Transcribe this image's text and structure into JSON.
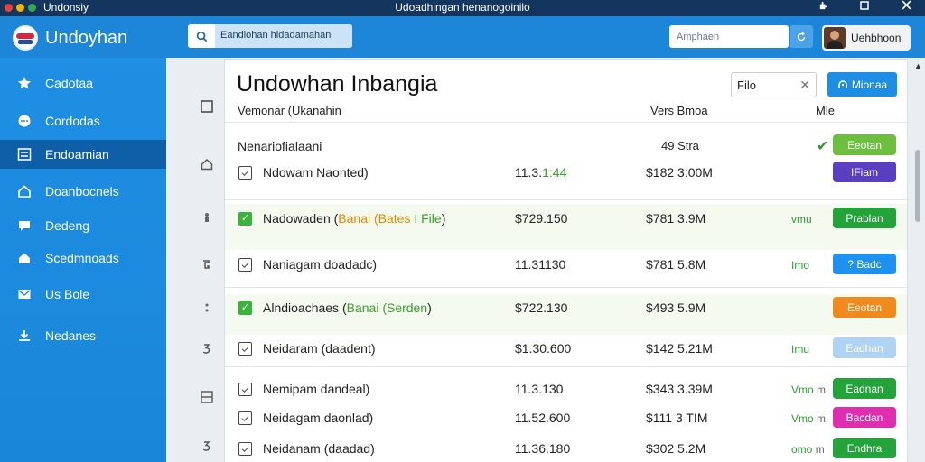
{
  "titlebar": {
    "app_name": "Undonsiy",
    "window_title": "Udoadhingan henanogoinilo",
    "dot_colors": [
      "#e8433a",
      "#f4b400",
      "#34a853"
    ]
  },
  "header": {
    "brand": "Undoyhan",
    "search_text": "Eandiohan hidadamahan",
    "search2_placeholder": "Amphaen",
    "user_name": "Uehbhoon"
  },
  "sidebar": {
    "items": [
      {
        "label": "Cadotaa",
        "icon": "star-icon"
      },
      {
        "label": "Cordodas",
        "icon": "chat-icon"
      },
      {
        "label": "Endoamian",
        "icon": "list-icon"
      },
      {
        "label": "Doanbocnels",
        "icon": "home-icon"
      },
      {
        "label": "Dedeng",
        "icon": "chat-icon"
      },
      {
        "label": "Scedmnoads",
        "icon": "home-icon"
      },
      {
        "label": "Us Bole",
        "icon": "mail-icon"
      },
      {
        "label": "Nedanes",
        "icon": "download-icon"
      }
    ]
  },
  "main": {
    "title": "Undowhan Inbangia",
    "filter_label": "Filo",
    "primary_button": "Mionaa",
    "columns": [
      "Vemonar (Ukanahin",
      "Vers Bmoa",
      "Mle"
    ],
    "group": {
      "label": "Nenariofialaani",
      "version": "49 Stra",
      "status_label": "Eeotan"
    },
    "rows": [
      {
        "name": "Ndowam Naonted)",
        "paren": "",
        "v1": "11.3.",
        "v1_green": "1:44",
        "v2": "$182 3:00M",
        "tag": "",
        "tag_x": "",
        "pill": "IFiam",
        "pill_color": "#5a3fc0",
        "checked": false
      },
      {
        "name": "Nadowaden (",
        "paren": "Banai (Bates",
        "paren2": " I File",
        "paren_end": ")",
        "v1": "$729.150",
        "v1_green": "",
        "v2": "$781 3.9M",
        "tag": "vmu",
        "tag_x": "",
        "pill": "Prablan",
        "pill_color": "#23a33a",
        "checked": true
      },
      {
        "name": "Naniagam doadadc)",
        "paren": "",
        "v1": "11.31130",
        "v1_green": "",
        "v2": "$781 5.8M",
        "tag": "Imo",
        "tag_x": "",
        "pill": "? Badc",
        "pill_color": "#1e90f0",
        "checked": false
      },
      {
        "name": "Alndioachaes (",
        "paren": "",
        "paren2": "Banai (Serden",
        "paren_end": ")",
        "v1": "$722.130",
        "v1_green": "",
        "v2": "$493 5.9M",
        "tag": "",
        "tag_x": "",
        "pill": "Eeotan",
        "pill_color": "#f18a1c",
        "checked": true
      },
      {
        "name": "Neidaram (daadent)",
        "paren": "",
        "v1": "$1.30.600",
        "v1_green": "",
        "v2": "$142 5.21M",
        "tag": "Imu",
        "tag_x": "",
        "pill": "Eadhan",
        "pill_color": "#b0d3f3",
        "checked": false
      },
      {
        "name": "Nemipam dandeal)",
        "paren": "",
        "v1": "11.3.130",
        "v1_green": "",
        "v2": "$343 3.39M",
        "tag": "Vmo",
        "tag_x": "m",
        "pill": "Eadnan",
        "pill_color": "#23a33a",
        "checked": false
      },
      {
        "name": "Neidagam daonlad)",
        "paren": "",
        "v1": "11.52.600",
        "v1_green": "",
        "v2": "$111 3 TIM",
        "tag": "Vmo",
        "tag_x": "m",
        "pill": "Bacdan",
        "pill_color": "#e02eb0",
        "checked": false
      },
      {
        "name": "Neidanam (daadad)",
        "paren": "",
        "v1": "11.36.180",
        "v1_green": "",
        "v2": "$302 5.2M",
        "tag": "omo",
        "tag_x": "m",
        "pill": "Endhra",
        "pill_color": "#23a33a",
        "checked": false
      }
    ]
  }
}
